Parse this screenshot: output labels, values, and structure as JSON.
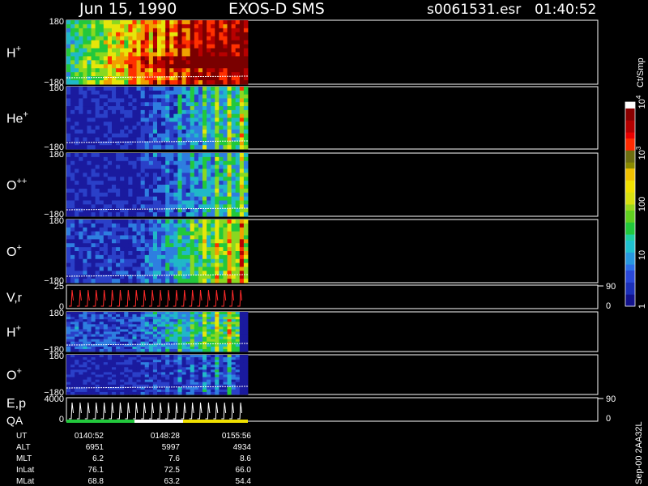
{
  "header": {
    "title": "Jun 15, 1990",
    "instrument": "EXOS-D SMS",
    "file": "s0061531.esr",
    "time": "01:40:52"
  },
  "chart_data": {
    "type": "heatmap",
    "panels": [
      {
        "id": "h-plus-1",
        "label": "H",
        "sup": "+",
        "ytop": "180",
        "ybot": "−180",
        "ymin": -180,
        "ymax": 180
      },
      {
        "id": "he-plus",
        "label": "He",
        "sup": "+",
        "ytop": "180",
        "ybot": "−180",
        "ymin": -180,
        "ymax": 180
      },
      {
        "id": "o-pp",
        "label": "O",
        "sup": "++",
        "ytop": "180",
        "ybot": "−180",
        "ymin": -180,
        "ymax": 180
      },
      {
        "id": "o-plus-1",
        "label": "O",
        "sup": "+",
        "ytop": "180",
        "ybot": "−180",
        "ymin": -180,
        "ymax": 180
      },
      {
        "id": "vr",
        "label": "V,r",
        "sup": "",
        "ytop": "25",
        "ybot": "0",
        "ymin": 0,
        "ymax": 25,
        "rtop": "90",
        "rbot": "0",
        "line": true
      },
      {
        "id": "h-plus-2",
        "label": "H",
        "sup": "+",
        "ytop": "180",
        "ybot": "−180",
        "ymin": -180,
        "ymax": 180
      },
      {
        "id": "o-plus-2",
        "label": "O",
        "sup": "+",
        "ytop": "180",
        "ybot": "−180",
        "ymin": -180,
        "ymax": 180
      },
      {
        "id": "ep",
        "label": "E,p",
        "label2": "QA",
        "sup": "",
        "ytop": "4000",
        "ybot": "0",
        "ymin": 0,
        "ymax": 4000,
        "rtop": "90",
        "rbot": "0",
        "line": true
      }
    ],
    "colorbar": {
      "unit": "Ct/Smp",
      "ticks": [
        {
          "label": "1",
          "value": 1
        },
        {
          "label": "10",
          "value": 10
        },
        {
          "label": "100",
          "value": 100
        },
        {
          "label": "10",
          "sup": "3",
          "value": 1000
        },
        {
          "label": "10",
          "sup": "4",
          "value": 10000
        }
      ],
      "scale": "log"
    },
    "time_axis": {
      "row_labels": [
        "UT",
        "ALT",
        "MLT",
        "InLat",
        "MLat"
      ],
      "columns": [
        {
          "UT": "0140:52",
          "ALT": "6951",
          "MLT": "6.2",
          "InLat": "76.1",
          "MLat": "68.8"
        },
        {
          "UT": "0148:28",
          "ALT": "5997",
          "MLT": "7.6",
          "InLat": "72.5",
          "MLat": "63.2"
        },
        {
          "UT": "0155:56",
          "ALT": "4934",
          "MLT": "8.6",
          "InLat": "66.0",
          "MLat": "54.4"
        }
      ]
    },
    "footer_note": "Sep-00 2AA32L",
    "colors": {
      "background": "#000000",
      "frame": "#ffffff",
      "vr_trace": "#ff2a2a",
      "qa_green": "#22c83c",
      "qa_yellow": "#f0e000"
    }
  }
}
